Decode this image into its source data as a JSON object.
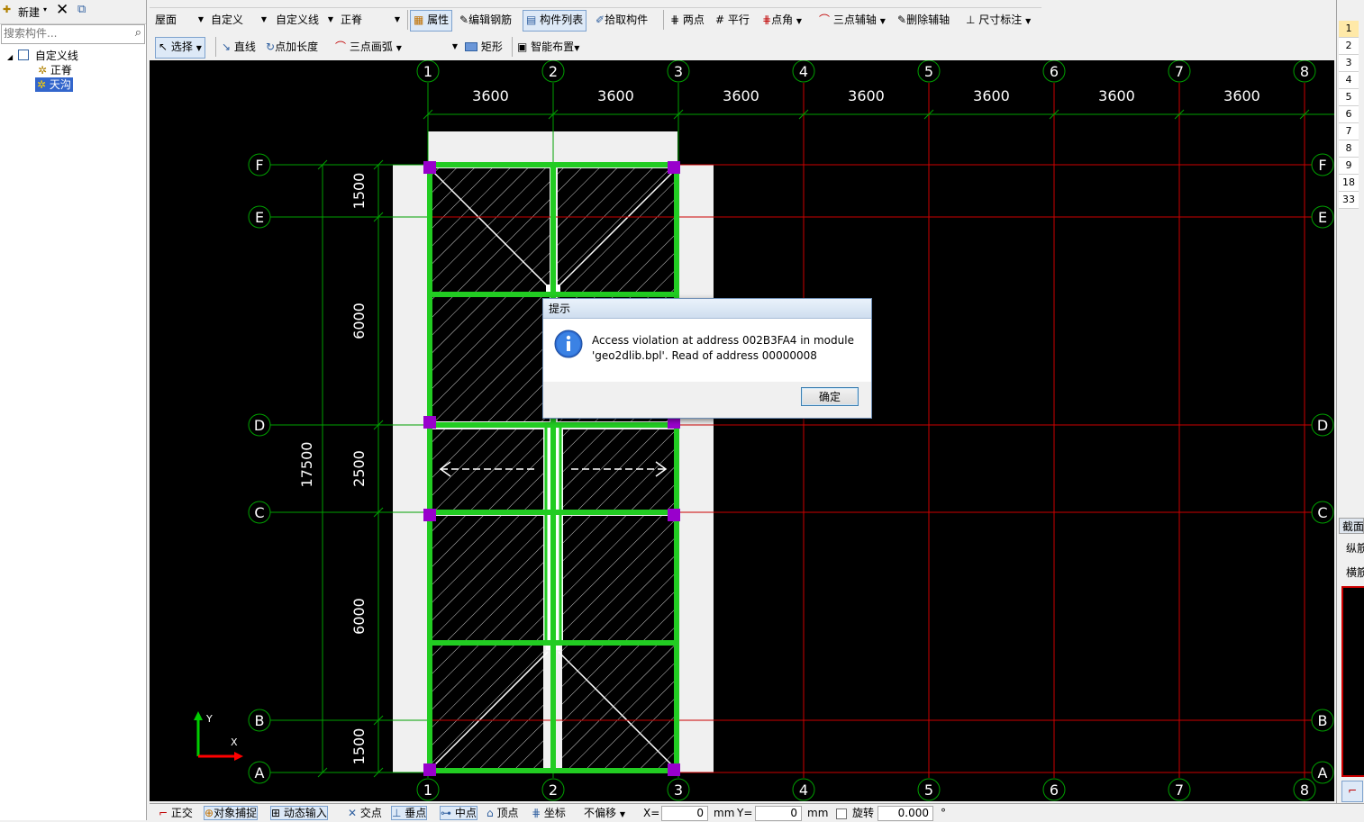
{
  "left_panel": {
    "new_label": "新建",
    "search_placeholder": "搜索构件...",
    "tree": {
      "root": "自定义线",
      "children": [
        "正脊",
        "天沟"
      ],
      "selected": "天沟"
    }
  },
  "toolbar1": {
    "floor_combo": "屋面",
    "type_combo": "自定义",
    "category_combo": "自定义线",
    "element_combo": "正脊",
    "properties": "属性",
    "edit_rebar": "编辑钢筋",
    "component_list": "构件列表",
    "pick_component": "拾取构件",
    "two_points": "两点",
    "parallel": "平行",
    "point_angle": "点角",
    "three_point_axis": "三点辅轴",
    "delete_axis": "删除辅轴",
    "dimension": "尺寸标注"
  },
  "toolbar2": {
    "select": "选择",
    "line": "直线",
    "point_length": "点加长度",
    "arc": "三点画弧",
    "rect": "矩形",
    "smart_layout": "智能布置"
  },
  "drawing": {
    "col_labels": [
      "1",
      "2",
      "3",
      "4",
      "5",
      "6",
      "7",
      "8"
    ],
    "col_spacing": [
      "3600",
      "3600",
      "3600",
      "3600",
      "3600",
      "3600",
      "3600"
    ],
    "row_labels": [
      "F",
      "E",
      "D",
      "C",
      "B",
      "A"
    ],
    "row_spacing": [
      "1500",
      "6000",
      "2500",
      "6000",
      "1500"
    ],
    "total_dim": "17500",
    "axis_x": "X",
    "axis_y": "Y",
    "colors": {
      "grid_red": "#cc0000",
      "grid_green": "#00a000",
      "beam": "#22cc22",
      "column": "#9900cc",
      "slab_bg": "#f0f0f0"
    }
  },
  "dialog": {
    "title": "提示",
    "line1": "Access violation at address 002B3FA4 in module",
    "line2": "'geo2dlib.bpl'. Read of address 00000008",
    "ok": "确定"
  },
  "right_panel": {
    "rows": [
      "1",
      "2",
      "3",
      "4",
      "5",
      "6",
      "7",
      "8",
      "9",
      "18",
      "33"
    ],
    "labels": [
      "截面",
      "纵筋",
      "横筋"
    ]
  },
  "status_bar": {
    "ortho": "正交",
    "snap": "对象捕捉",
    "dynamic_input": "动态输入",
    "intersection": "交点",
    "perpendicular": "垂点",
    "midpoint": "中点",
    "vertex": "顶点",
    "coordinate": "坐标",
    "offset_mode": "不偏移",
    "x_label": "X=",
    "x_value": "0",
    "x_unit": "mm",
    "y_label": "Y=",
    "y_value": "0",
    "y_unit": "mm",
    "rotate_label": "旋转",
    "rotate_value": "0.000",
    "degree": "°"
  }
}
